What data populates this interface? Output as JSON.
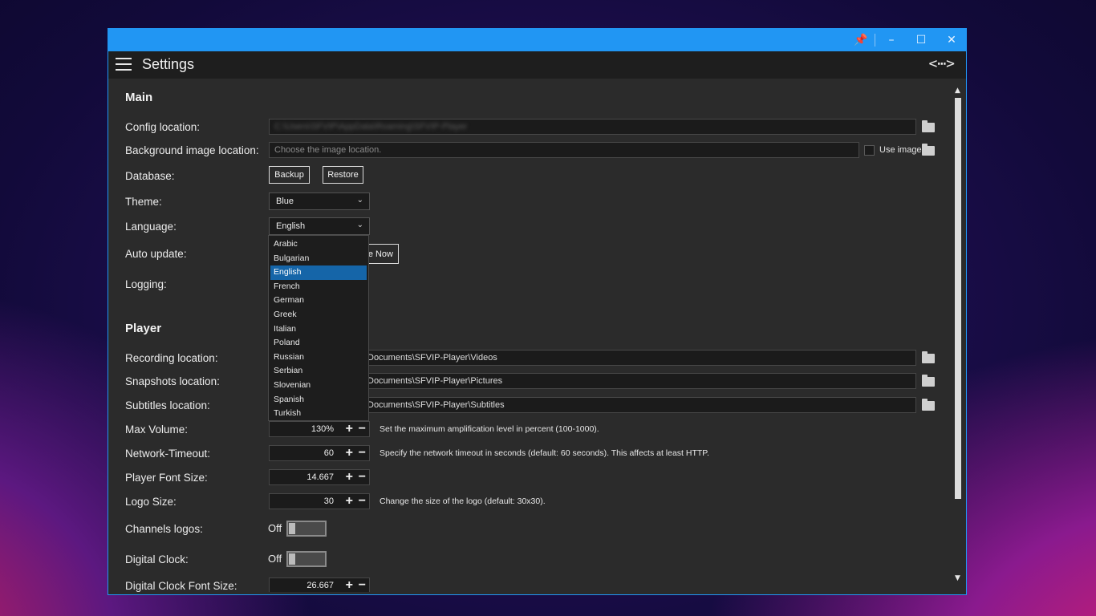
{
  "window": {
    "titlebar_icons": [
      "pin-icon",
      "minimize-icon",
      "maximize-icon",
      "close-icon"
    ],
    "header_title": "Settings",
    "accent_color": "#2196f3"
  },
  "main": {
    "section_title": "Main",
    "config_label": "Config location:",
    "config_value": "C:\\Users\\SFVIP\\AppData\\Roaming\\SFVIP-Player",
    "bg_label": "Background image location:",
    "bg_placeholder": "Choose the image location.",
    "use_image_label": "Use image",
    "database_label": "Database:",
    "backup_label": "Backup",
    "restore_label": "Restore",
    "theme_label": "Theme:",
    "theme_value": "Blue",
    "language_label": "Language:",
    "language_value": "English",
    "autoupdate_label": "Auto update:",
    "update_now_label": "e Now",
    "logging_label": "Logging:"
  },
  "language_options": [
    "Arabic",
    "Bulgarian",
    "English",
    "French",
    "German",
    "Greek",
    "Italian",
    "Poland",
    "Russian",
    "Serbian",
    "Slovenian",
    "Spanish",
    "Turkish"
  ],
  "player": {
    "section_title": "Player",
    "recording_label": "Recording location:",
    "recording_value": "Documents\\SFVIP-Player\\Videos",
    "snapshots_label": "Snapshots location:",
    "snapshots_value": "Documents\\SFVIP-Player\\Pictures",
    "subtitles_label": "Subtitles location:",
    "subtitles_value": "Documents\\SFVIP-Player\\Subtitles",
    "maxvol_label": "Max Volume:",
    "maxvol_value": "130%",
    "maxvol_hint": "Set the maximum amplification level in percent (100-1000).",
    "timeout_label": "Network-Timeout:",
    "timeout_value": "60",
    "timeout_hint": "Specify the network timeout in seconds (default: 60 seconds). This affects at least HTTP.",
    "fontsize_label": "Player Font Size:",
    "fontsize_value": "14.667",
    "logosize_label": "Logo Size:",
    "logosize_value": "30",
    "logosize_hint": "Change the size of the logo (default: 30x30).",
    "channels_logos_label": "Channels logos:",
    "channels_logos_state": "Off",
    "digital_clock_label": "Digital Clock:",
    "digital_clock_state": "Off",
    "clock_font_label": "Digital Clock Font Size:",
    "clock_font_value": "26.667"
  }
}
